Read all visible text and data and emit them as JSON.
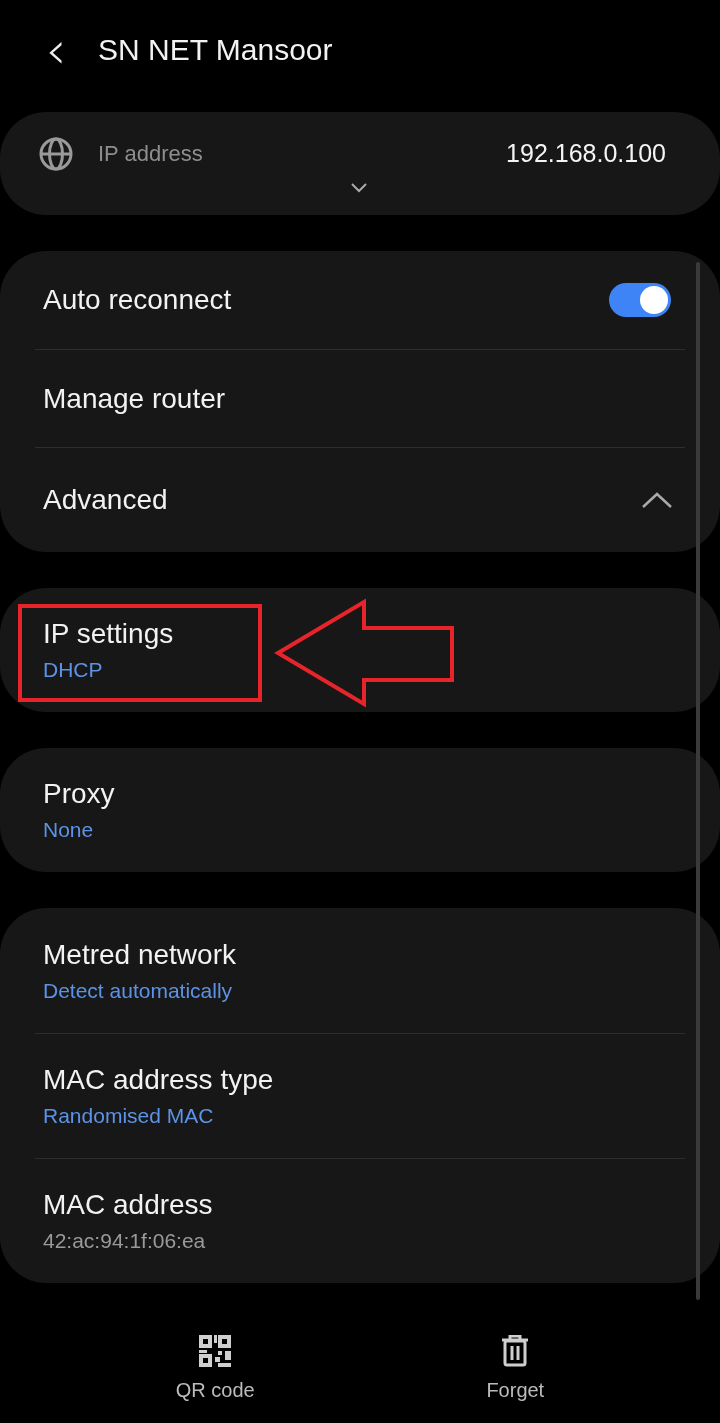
{
  "header": {
    "back": "‹",
    "title": "SN NET Mansoor"
  },
  "ip_card": {
    "label": "IP address",
    "value": "192.168.0.100",
    "expanded": false
  },
  "groups": [
    {
      "items": [
        {
          "kind": "toggle",
          "title": "Auto reconnect",
          "on": true
        },
        {
          "kind": "plain",
          "title": "Manage router"
        },
        {
          "kind": "expander",
          "title": "Advanced",
          "expanded": true
        }
      ]
    },
    {
      "highlighted": true,
      "items": [
        {
          "kind": "value",
          "title": "IP settings",
          "subtitle": "DHCP"
        }
      ]
    },
    {
      "items": [
        {
          "kind": "value",
          "title": "Proxy",
          "subtitle": "None"
        }
      ]
    },
    {
      "items": [
        {
          "kind": "value",
          "title": "Metred network",
          "subtitle": "Detect automatically"
        },
        {
          "kind": "value",
          "title": "MAC address type",
          "subtitle": "Randomised MAC"
        },
        {
          "kind": "info",
          "title": "MAC address",
          "subtitle": "42:ac:94:1f:06:ea"
        }
      ]
    }
  ],
  "bottom_bar": [
    {
      "label": "QR code"
    },
    {
      "label": "Forget"
    }
  ]
}
